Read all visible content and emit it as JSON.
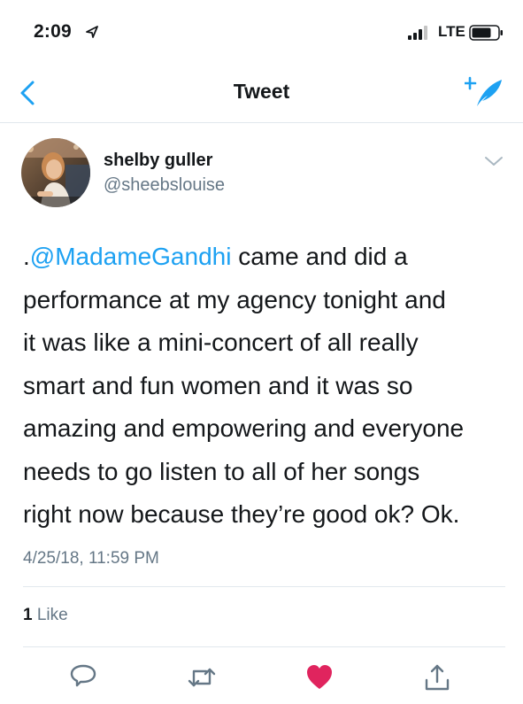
{
  "status_bar": {
    "time": "2:09",
    "network": "LTE",
    "icons": [
      "location-arrow-icon",
      "signal-bars-icon",
      "battery-icon"
    ]
  },
  "nav": {
    "title": "Tweet",
    "icons": [
      "back-chevron-icon",
      "compose-tweet-icon"
    ]
  },
  "tweet": {
    "author": {
      "display_name": "shelby guller",
      "handle": "@sheebslouise"
    },
    "text": {
      "prefix": ".",
      "mention": "@MadameGandhi",
      "line1_rest": " came and did a",
      "line2": "performance at my agency tonight and",
      "line3": "it was like a mini-concert of all really",
      "line4": "smart and fun women and it was so",
      "line5": "amazing and empowering and everyone",
      "line6": "needs to go listen to all of her songs",
      "line7": "right now because they’re good ok? Ok."
    },
    "timestamp": "4/25/18, 11:59 PM",
    "likes": {
      "count": "1",
      "label": "Like"
    }
  },
  "actions": {
    "icons": [
      "reply-icon",
      "retweet-icon",
      "like-heart-icon",
      "share-icon"
    ]
  },
  "colors": {
    "accent": "#1da1f2",
    "like": "#e0245e",
    "secondary_text": "#657786",
    "divider": "#e1e8ed"
  }
}
